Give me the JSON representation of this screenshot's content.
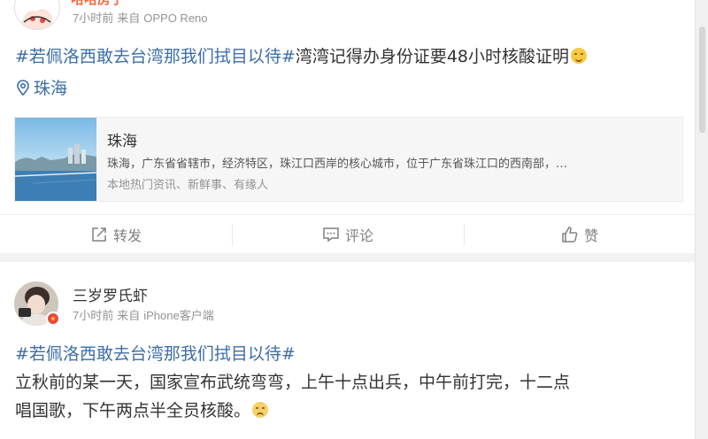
{
  "post1": {
    "author": "哈哈房子",
    "time": "7小时前",
    "source_prefix": "来自",
    "source": "OPPO Reno",
    "topic": "#若佩洛西敢去台湾那我们拭目以待#",
    "text": "湾湾记得办身份证要48小时核酸证明",
    "location": "珠海",
    "link_card": {
      "title": "珠海",
      "description": "珠海，广东省省辖市，经济特区，珠江口西岸的核心城市，位于广东省珠江口的西南部，…",
      "subtitle": "本地热门资讯、新鲜事、有缘人"
    },
    "actions": {
      "repost": "转发",
      "comment": "评论",
      "like": "赞"
    }
  },
  "post2": {
    "author": "三岁罗氏虾",
    "time": "7小时前",
    "source_prefix": "来自",
    "source": "iPhone客户端",
    "topic": "#若佩洛西敢去台湾那我们拭目以待#",
    "line1": "立秋前的某一天，国家宣布武统弯弯，上午十点出兵，中午前打完，十二点",
    "line2": "唱国歌，下午两点半全员核酸。"
  },
  "colors": {
    "topic_link": "#3c6ea8",
    "meta_gray": "#939393",
    "author1": "#f26a3c",
    "verified_badge": "#e8493a"
  }
}
